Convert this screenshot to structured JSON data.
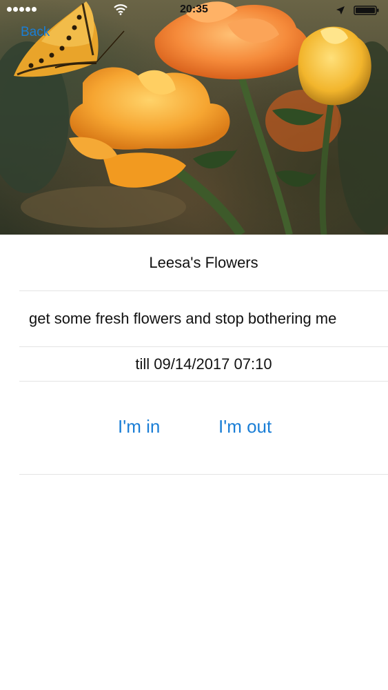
{
  "status_bar": {
    "time": "20:35",
    "signal_icon": "signal-dots-icon",
    "wifi_icon": "wifi-icon",
    "location_icon": "location-arrow-icon",
    "battery_icon": "battery-icon"
  },
  "nav": {
    "back_label": "Back"
  },
  "hero": {
    "image": "flowers-butterfly-photo"
  },
  "event": {
    "title": "Leesa's Flowers",
    "description": "get some fresh flowers and stop bothering me",
    "deadline": "till 09/14/2017 07:10"
  },
  "actions": {
    "in_label": "I'm in",
    "out_label": "I'm out"
  },
  "colors": {
    "accent": "#1a7ed6",
    "separator": "#e4e4e4",
    "text": "#111111"
  }
}
